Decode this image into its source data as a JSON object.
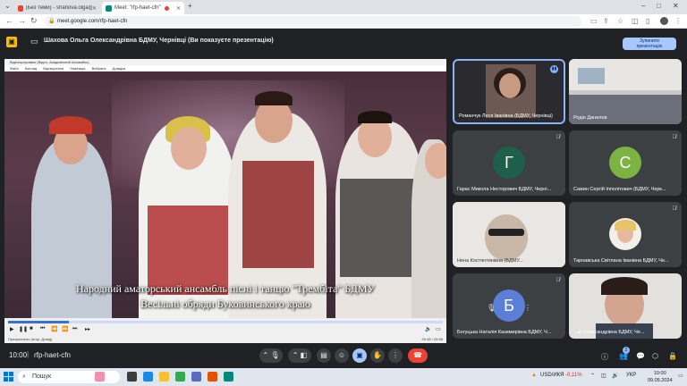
{
  "browser": {
    "tabs": [
      {
        "label": "(Без теми) - shahova.olga@bdm..."
      },
      {
        "label": "Meet: \"rfp-haet-cfn\""
      }
    ],
    "new_tab": "+",
    "url": "meet.google.com/rfp-haet-cfn"
  },
  "presentation": {
    "title": "Шахова Ольга Олександрівна БДМУ, Чернівці (Ви показуєте презентацію)",
    "stop_button_line1": "Зупинити",
    "stop_button_line2": "презентацію",
    "window_title": "Відеопрогравач (Відео, Академічний Ансамбль)",
    "window_menu": [
      "Файл",
      "Вигляд",
      "Відтворення",
      "Навігація",
      "Вибране",
      "Довідка"
    ],
    "subtitle_line1": "Народний аматорський ансамбль пісні і танцю \"Трембіта\" БДМУ",
    "subtitle_line2": "Весільні обряди Буковинського краю",
    "player_status": "Призупинено (Агор, Довід)",
    "player_time": "00:48 / 05:58",
    "progress": 0.14
  },
  "participants": [
    {
      "name": "Романчук Леся Іванівна (БДМУ, Чернівці)",
      "type": "video",
      "speaking": true
    },
    {
      "name": "Родіо Данилов",
      "type": "video",
      "muted": false
    },
    {
      "name": "Гарас Микола Несторович БДМУ, Черні...",
      "type": "avatar",
      "initial": "Г",
      "color": "#1e5f4a",
      "muted": true
    },
    {
      "name": "Сажин Сергій Іпполітович (БДМУ, Черк...",
      "type": "avatar",
      "initial": "С",
      "color": "#7cb342",
      "muted": true
    },
    {
      "name": "Нена Костянтинівна (БДМУ...",
      "type": "video",
      "muted": true
    },
    {
      "name": "Тарнавська Світлана Іванівна БДМУ, Че...",
      "type": "photo",
      "muted": true
    },
    {
      "name": "Богуцька Наталія Казимирівна БДМУ, Ч...",
      "type": "avatar",
      "initial": "Б",
      "color": "#5b7fd6",
      "muted": true
    },
    {
      "name": "...ш Олександрівна БДМУ, Че...",
      "type": "video",
      "muted": true
    }
  ],
  "bottom": {
    "time": "10:00",
    "separator": "|",
    "meeting_code": "rfp-haet-cfn",
    "participant_badge": "2"
  },
  "taskbar": {
    "search_placeholder": "Пошук",
    "ticker": "USD/ИКЯ",
    "ticker_change": "-0,11%",
    "lang": "УКР",
    "clock_time": "10:00",
    "clock_date": "09.05.2024"
  },
  "colors": {
    "accent": "#a8c7fa",
    "end_call": "#ea4335",
    "meet_bg": "#202124"
  }
}
